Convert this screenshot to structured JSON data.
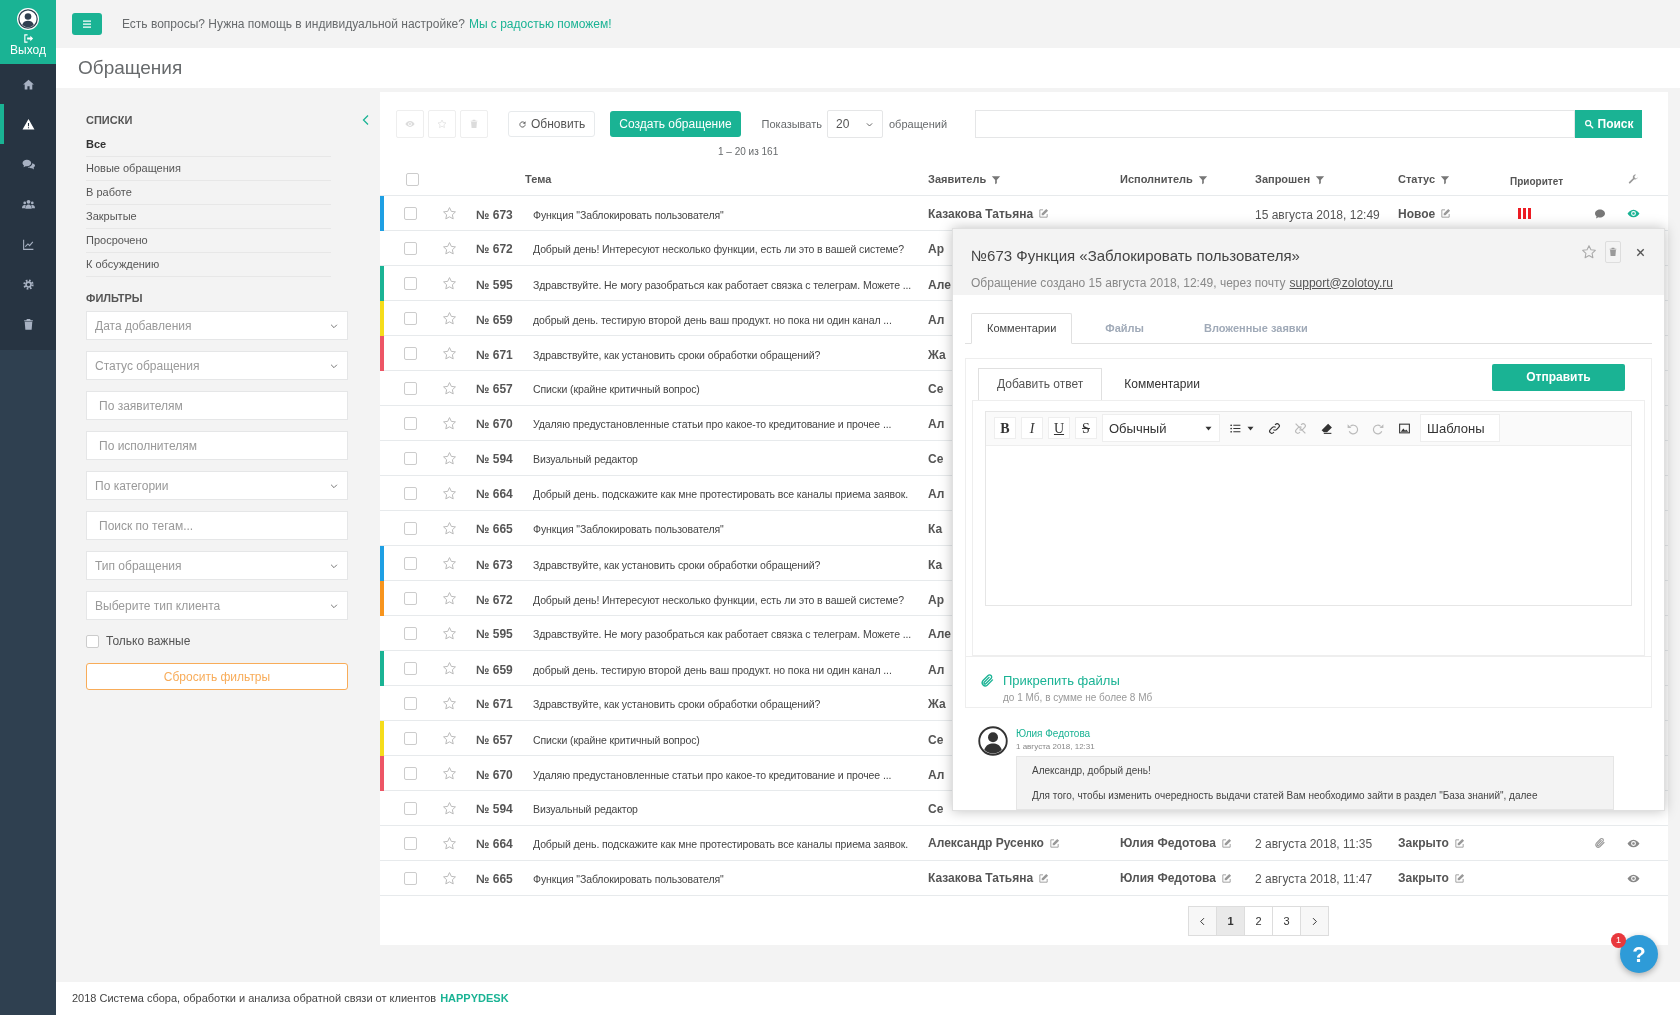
{
  "nav": {
    "logout": "Выход",
    "items": [
      {
        "kind": "home",
        "selected": false
      },
      {
        "kind": "alert",
        "selected": true
      },
      {
        "kind": "chat",
        "selected": false
      },
      {
        "kind": "users",
        "selected": false
      },
      {
        "kind": "chart",
        "selected": false
      },
      {
        "kind": "settings",
        "selected": false
      },
      {
        "kind": "trash",
        "selected": false
      }
    ]
  },
  "topbar": {
    "text": "Есть вопросы? Нужна помощь в индивидуальной настройке?",
    "link": "Мы с радостью поможем!"
  },
  "page_title": "Обращения",
  "sidebar": {
    "lists_title": "СПИСКИ",
    "lists": [
      {
        "label": "Все",
        "selected": true
      },
      {
        "label": "Новые обращения",
        "selected": false
      },
      {
        "label": "В работе",
        "selected": false
      },
      {
        "label": "Закрытые",
        "selected": false
      },
      {
        "label": "Просрочено",
        "selected": false
      },
      {
        "label": "К обсуждению",
        "selected": false
      }
    ],
    "filters_title": "ФИЛЬТРЫ",
    "filters": [
      {
        "kind": "select",
        "placeholder": "Дата добавления"
      },
      {
        "kind": "select",
        "placeholder": "Статус обращения"
      },
      {
        "kind": "input",
        "placeholder": "По заявителям"
      },
      {
        "kind": "input",
        "placeholder": "По исполнителям"
      },
      {
        "kind": "select",
        "placeholder": "По категории"
      },
      {
        "kind": "input",
        "placeholder": "Поиск по тегам..."
      },
      {
        "kind": "select",
        "placeholder": "Тип обращения"
      },
      {
        "kind": "select",
        "placeholder": "Выберите тип клиента"
      }
    ],
    "important": {
      "label": "Только важные",
      "checked": false
    },
    "reset": "Сбросить фильтры"
  },
  "toolbar": {
    "icon_buttons": [
      {
        "kind": "eye",
        "disabled": true
      },
      {
        "kind": "star",
        "disabled": true
      },
      {
        "kind": "trash",
        "disabled": true
      }
    ],
    "refresh": "Обновить",
    "create": "Создать обращение",
    "show_label": "Показывать",
    "page_size": "20",
    "show_suffix": "обращений",
    "search_button": "Поиск",
    "summary": "1 – 20 из 161"
  },
  "table": {
    "columns": [
      {
        "label": "Тема",
        "filter": false
      },
      {
        "label": "Заявитель",
        "filter": true
      },
      {
        "label": "Исполнитель",
        "filter": true
      },
      {
        "label": "Запрошен",
        "filter": true
      },
      {
        "label": "Статус",
        "filter": true
      },
      {
        "label": "Приоритет",
        "filter": false
      }
    ],
    "all_checked": false,
    "rows": [
      {
        "number": "№ 673",
        "subject": "Функция \"Заблокировать пользователя\"",
        "applicant": "Казакова Татьяна",
        "requested": "15 августа 2018, 12:49",
        "status": "Новое",
        "priority": {
          "color": "#ed1c24"
        },
        "has_comment": true,
        "has_attachment": false,
        "checked": false,
        "starred": false,
        "color": "#1e9fe3"
      },
      {
        "number": "№ 672",
        "subject": "Добрый день! Интересуют несколько функции, есть ли это в вашей системе?",
        "applicant": "Ар",
        "checked": false,
        "starred": false
      },
      {
        "number": "№ 595",
        "subject": "Здравствуйте. Не могу разобраться как работает связка с телеграм. Можете ...",
        "applicant": "Але",
        "checked": false,
        "starred": false,
        "color": "#1ab394"
      },
      {
        "number": "№ 659",
        "subject": "добрый день. тестирую второй день ваш продукт. но пока ни один канал ...",
        "applicant": "Ал",
        "checked": false,
        "starred": false,
        "color": "#f5dc1a"
      },
      {
        "number": "№ 671",
        "subject": "Здравствуйте, как установить сроки обработки обращений?",
        "applicant": "Жа",
        "checked": false,
        "starred": false,
        "color": "#ed5565"
      },
      {
        "number": "№ 657",
        "subject": "Списки (крайне критичный вопрос)",
        "applicant": "Се",
        "checked": false,
        "starred": false
      },
      {
        "number": "№ 670",
        "subject": "Удаляю предустановленные статьи про какое-то кредитование и прочее ...",
        "applicant": "Ал",
        "checked": false,
        "starred": false
      },
      {
        "number": "№ 594",
        "subject": "Визуальный редактор",
        "applicant": "Се",
        "checked": false,
        "starred": false
      },
      {
        "number": "№ 664",
        "subject": "Добрый день. подскажите как мне протестировать все каналы приема заявок.",
        "applicant": "Ал",
        "checked": false,
        "starred": false
      },
      {
        "number": "№ 665",
        "subject": "Функция \"Заблокировать пользователя\"",
        "applicant": "Ка",
        "checked": false,
        "starred": false
      },
      {
        "number": "№ 673",
        "subject": "Здравствуйте, как установить сроки обработки обращений?",
        "applicant": "Ка",
        "checked": false,
        "starred": false,
        "color": "#1e9fe3"
      },
      {
        "number": "№ 672",
        "subject": "Добрый день! Интересуют несколько функции, есть ли это в вашей системе?",
        "applicant": "Ар",
        "checked": false,
        "starred": false,
        "color": "#f7941d"
      },
      {
        "number": "№ 595",
        "subject": "Здравствуйте. Не могу разобраться как работает связка с телеграм. Можете ...",
        "applicant": "Але",
        "checked": false,
        "starred": false
      },
      {
        "number": "№ 659",
        "subject": "добрый день. тестирую второй день ваш продукт. но пока ни один канал ...",
        "applicant": "Ал",
        "checked": false,
        "starred": false,
        "color": "#1ab394"
      },
      {
        "number": "№ 671",
        "subject": "Здравствуйте, как установить сроки обработки обращений?",
        "applicant": "Жа",
        "checked": false,
        "starred": false
      },
      {
        "number": "№ 657",
        "subject": "Списки (крайне критичный вопрос)",
        "applicant": "Се",
        "checked": false,
        "starred": false,
        "color": "#f5dc1a"
      },
      {
        "number": "№ 670",
        "subject": "Удаляю предустановленные статьи про какое-то кредитование и прочее ...",
        "applicant": "Ал",
        "checked": false,
        "starred": false,
        "color": "#ed5565"
      },
      {
        "number": "№ 594",
        "subject": "Визуальный редактор",
        "applicant": "Се",
        "checked": false,
        "starred": false
      },
      {
        "number": "№ 664",
        "subject": "Добрый день. подскажите как мне протестировать все каналы приема заявок.",
        "applicant": "Александр Русенко",
        "executor": "Юлия Федотова",
        "requested": "2 августа 2018, 11:35",
        "status": "Закрыто",
        "has_comment": false,
        "has_attachment": true,
        "checked": false,
        "starred": false
      },
      {
        "number": "№ 665",
        "subject": "Функция \"Заблокировать пользователя\"",
        "applicant": "Казакова Татьяна",
        "executor": "Юлия Федотова",
        "requested": "2 августа 2018, 11:47",
        "status": "Закрыто",
        "has_comment": false,
        "has_attachment": false,
        "checked": false,
        "starred": false
      }
    ]
  },
  "pagination": [
    {
      "kind": "prev",
      "selected": false
    },
    {
      "kind": "page",
      "label": "1",
      "selected": true
    },
    {
      "kind": "page",
      "label": "2",
      "selected": false
    },
    {
      "kind": "page",
      "label": "3",
      "selected": false
    },
    {
      "kind": "next",
      "selected": false
    }
  ],
  "panel": {
    "title": "№673 Функция «Заблокировать пользователя»",
    "subtitle": "Обращение создано 15 августа 2018, 12:49, через почту",
    "email": "support@zolotoy.ru",
    "starred": false,
    "tabs": [
      {
        "label": "Комментарии",
        "selected": true
      },
      {
        "label": "Файлы",
        "selected": false
      },
      {
        "label": "Вложенные заявки",
        "selected": false
      }
    ],
    "reply_tabs": [
      {
        "label": "Добавить ответ",
        "selected": true
      },
      {
        "label": "Комментарии",
        "selected": false
      }
    ],
    "send": "Отправить",
    "tools": [
      {
        "kind": "bold",
        "label": "B",
        "disabled": false
      },
      {
        "kind": "italic",
        "label": "I",
        "disabled": false
      },
      {
        "kind": "underline",
        "label": "U",
        "disabled": false
      },
      {
        "kind": "strike",
        "label": "S",
        "disabled": false
      },
      {
        "kind": "select",
        "label": "Обычный",
        "disabled": false
      },
      {
        "kind": "list",
        "disabled": false
      },
      {
        "kind": "link",
        "disabled": false
      },
      {
        "kind": "unlink",
        "disabled": true
      },
      {
        "kind": "eraser",
        "disabled": false
      },
      {
        "kind": "undo",
        "disabled": true
      },
      {
        "kind": "redo",
        "disabled": true
      },
      {
        "kind": "image",
        "disabled": false
      },
      {
        "kind": "select",
        "label": "Шаблоны",
        "disabled": false
      }
    ],
    "attach": "Прикрепить файлы",
    "attach_hint": "до 1 Мб, в сумме не более 8 Мб",
    "comment": {
      "author": "Юлия Федотова",
      "date": "1 августа 2018, 12:31",
      "lines": [
        "Александр, добрый день!",
        "Для того, чтобы изменить очередность выдачи статей Вам необходимо зайти в раздел \"База знаний\", далее"
      ]
    }
  },
  "footer": {
    "text": "2018 Система сбора, обработки и анализа обратной связи от клиентов",
    "brand": "HAPPYDESK"
  },
  "help": {
    "label": "?",
    "badge": "1"
  }
}
